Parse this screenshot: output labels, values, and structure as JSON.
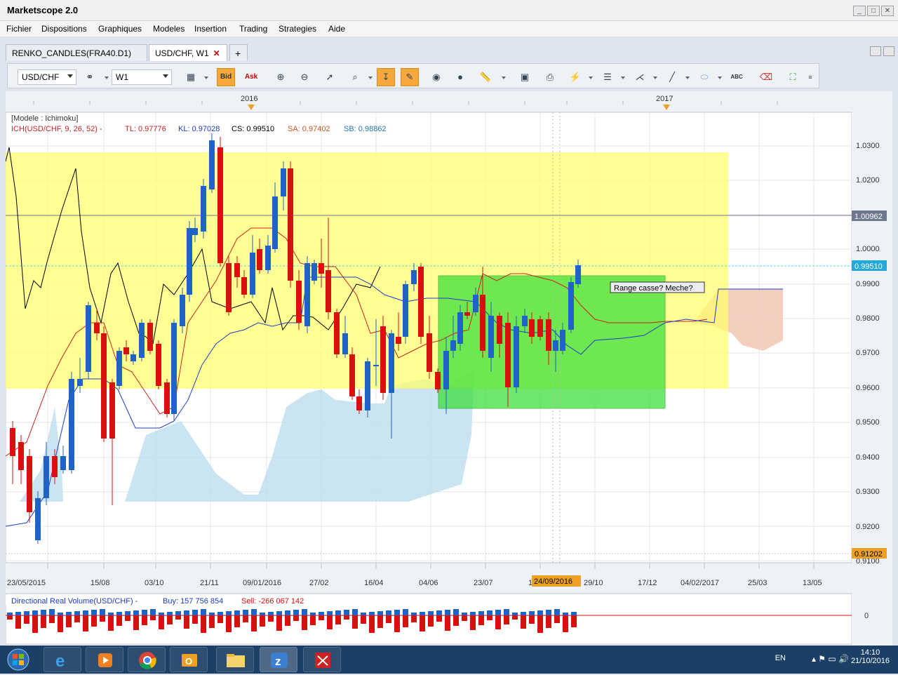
{
  "window": {
    "title": "Marketscope 2.0",
    "buttons": [
      "_",
      "□",
      "✕"
    ]
  },
  "menu": [
    "Fichier",
    "Dispositions",
    "Graphiques",
    "Modeles",
    "Insertion",
    "Trading",
    "Strategies",
    "Aide"
  ],
  "tabs": [
    {
      "label": "RENKO_CANDLES(FRA40.D1)",
      "active": false
    },
    {
      "label": "USD/CHF, W1",
      "active": true,
      "close": "✕"
    }
  ],
  "tab_add": "+",
  "toolbar": {
    "symbol": "USD/CHF",
    "timeframe": "W1",
    "bid_label": "Bid",
    "ask_label": "Ask",
    "abc_label": "ABC"
  },
  "chart": {
    "year_labels": [
      "2016",
      "2017"
    ],
    "legend_model": "[Modele : Ichimoku]",
    "legend_ich": "ICH(USD/CHF, 9, 26, 52) -",
    "legend_tl": "TL: 0.97776",
    "legend_kl": "KL: 0.97028",
    "legend_cs": "CS: 0.99510",
    "legend_sa": "SA: 0.97402",
    "legend_sb": "SB: 0.98862",
    "price_ticks": [
      "1.0300",
      "1.0200",
      "1.0100",
      "1.0000",
      "0.9900",
      "0.9800",
      "0.9700",
      "0.9600",
      "0.9500",
      "0.9400",
      "0.9300",
      "0.9200",
      "0.9100"
    ],
    "price_tag_line": "1.00962",
    "price_tag_current": "0.99510",
    "price_tag_low": "0.91202",
    "annotation": "Range casse? Meche?",
    "date_ticks": [
      "23/05/2015",
      "15/08",
      "03/10",
      "21/11",
      "09/01/2016",
      "27/02",
      "16/04",
      "04/06",
      "23/07",
      "1",
      "29/10",
      "17/12",
      "04/02/2017",
      "25/03",
      "13/05"
    ],
    "date_cursor": "24/09/2016",
    "colors": {
      "bull": "#1f63c6",
      "bear": "#d81010",
      "range_yellow": "#ffff66",
      "range_green": "#33dd33",
      "cloud_blue": "#b9dbee",
      "cloud_red": "#f2c6b4"
    }
  },
  "volume": {
    "title": "Directional Real Volume(USD/CHF) -",
    "buy": "Buy: 157 756 854",
    "sell": "Sell: -266 067 142",
    "zero": "0"
  },
  "taskbar": {
    "lang": "EN",
    "time": "14:10",
    "date": "21/10/2016"
  }
}
